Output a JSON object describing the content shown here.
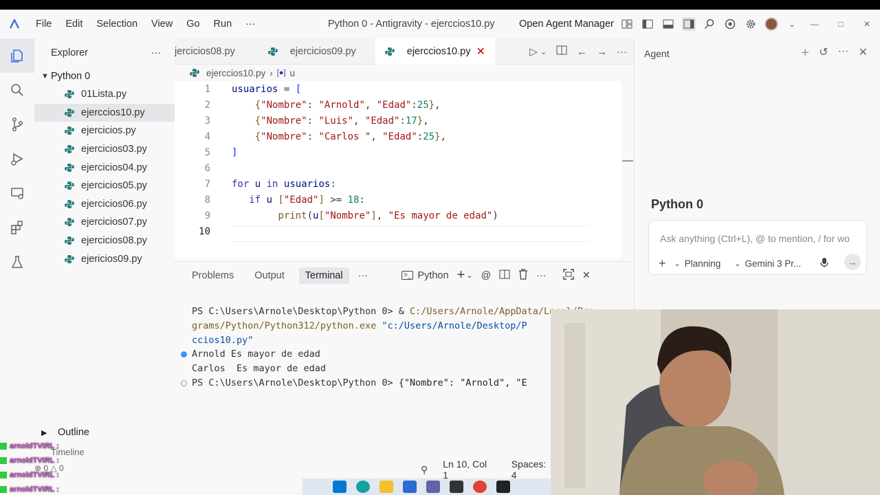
{
  "titlebar": {
    "menu": [
      "File",
      "Edit",
      "Selection",
      "View",
      "Go",
      "Run"
    ],
    "more": "···",
    "window_title": "Python 0 - Antigravity - ejerccios10.py",
    "agent_manager": "Open Agent Manager"
  },
  "sidebar": {
    "title": "Explorer",
    "more": "···",
    "folder": "Python 0",
    "files": [
      "01Lista.py",
      "ejerccios10.py",
      "ejercicios.py",
      "ejercicios03.py",
      "ejercicios04.py",
      "ejercicios05.py",
      "ejercicios06.py",
      "ejercicios07.py",
      "ejercicios08.py",
      "ejericios09.py"
    ],
    "active_file": "ejerccios10.py",
    "outline": "Outline",
    "timeline": "Timeline"
  },
  "tabs": [
    {
      "label": "jercicios08.py",
      "active": false
    },
    {
      "label": "ejercicios09.py",
      "active": false
    },
    {
      "label": "ejerccios10.py",
      "active": true
    }
  ],
  "breadcrumb": {
    "file": "ejerccios10.py",
    "symbol": "u"
  },
  "editor": {
    "line_numbers": [
      "1",
      "2",
      "3",
      "4",
      "5",
      "6",
      "7",
      "8",
      "9",
      "10"
    ],
    "current_line": "10"
  },
  "panel": {
    "tabs": [
      "Problems",
      "Output",
      "Terminal"
    ],
    "active_tab": "Terminal",
    "more": "···",
    "shell": "Python",
    "terminal": {
      "line1_prompt": "PS C:\\Users\\Arnole\\Desktop\\Python 0> & ",
      "line1_exe": "C:/Users/Arnole/AppData/Local/Pro",
      "line2_exe": "grams/Python/Python312/python.exe",
      "line2_arg": " \"c:/Users/Arnole/Desktop/P",
      "line3_arg": "ccios10.py\"",
      "out1": "Arnold Es mayor de edad",
      "out2": "Carlos  Es mayor de edad",
      "line6_prompt": "PS C:\\Users\\Arnole\\Desktop\\Python 0> ",
      "line6_cmd": "{\"Nombre\": \"Arnold\", \"E"
    }
  },
  "agent": {
    "header": "Agent",
    "title": "Python 0",
    "input_placeholder": "Ask anything (Ctrl+L), @ to mention, / for wo",
    "mode": "Planning",
    "model": "Gemini 3 Pr..."
  },
  "statusbar": {
    "position": "Ln 10, Col 1",
    "spaces": "Spaces: 4"
  },
  "problems": {
    "errors": "0",
    "warnings": "0"
  },
  "chat": {
    "username": "arnoldTVIRL :",
    "rows": 4
  },
  "colors": {
    "accent": "#3b6ee6",
    "keyword": "#3a2fb3",
    "string": "#a31515",
    "number": "#098658"
  }
}
